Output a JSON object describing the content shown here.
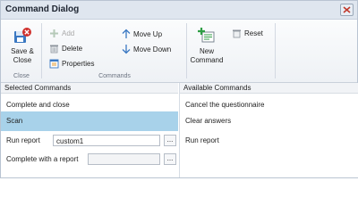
{
  "window": {
    "title": "Command Dialog"
  },
  "ribbon": {
    "close_group": {
      "label": "Close",
      "save_close_line1": "Save &",
      "save_close_line2": "Close"
    },
    "commands_group": {
      "label": "Commands",
      "add": "Add",
      "delete": "Delete",
      "properties": "Properties",
      "move_up": "Move Up",
      "move_down": "Move Down"
    },
    "new_group": {
      "new_line1": "New",
      "new_line2": "Command",
      "reset": "Reset"
    }
  },
  "selected_commands": {
    "header": "Selected Commands",
    "rows": [
      {
        "label": "Complete and close"
      },
      {
        "label": "Scan",
        "selected": true
      },
      {
        "label": "Run report",
        "value": "custom1",
        "button": "..."
      },
      {
        "label": "Complete with a report",
        "value": "",
        "button": "..."
      }
    ]
  },
  "available_commands": {
    "header": "Available Commands",
    "items": [
      "Cancel the questionnaire",
      "Clear answers",
      "Run report"
    ]
  },
  "colors": {
    "selection": "#a8d2ea",
    "accent_blue": "#3a78c2",
    "danger_red": "#d0312d",
    "add_green": "#2f9e44"
  },
  "icons": {
    "save_close": "save-close-icon",
    "add": "plus-icon",
    "delete": "trash-icon",
    "properties": "properties-icon",
    "move_up": "arrow-up-icon",
    "move_down": "arrow-down-icon",
    "new_command": "new-command-icon",
    "reset": "reset-icon",
    "close": "close-icon"
  }
}
